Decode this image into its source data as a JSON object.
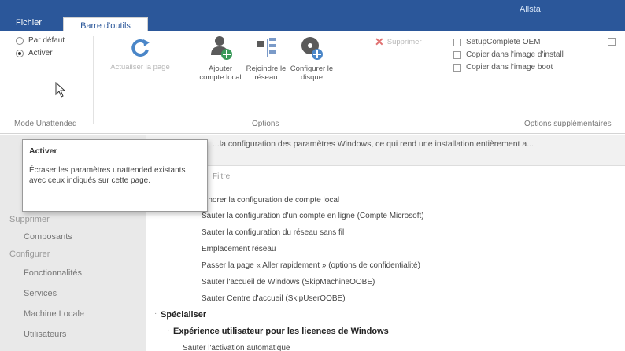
{
  "app": {
    "title": "Allsta"
  },
  "tabs": [
    {
      "label": "Fichier"
    },
    {
      "label": "Barre d'outils"
    }
  ],
  "ribbon": {
    "unattended": {
      "options": [
        {
          "label": "Par défaut",
          "checked": false
        },
        {
          "label": "Activer",
          "checked": true
        }
      ],
      "group_label": "Mode Unattended"
    },
    "buttons": {
      "refresh": {
        "label": "Actualiser la page",
        "icon": "refresh-icon",
        "enabled": false
      },
      "add_account": {
        "label": "Ajouter compte local",
        "icon": "add-user-icon"
      },
      "join_network": {
        "label": "Rejoindre le réseau",
        "icon": "network-icon"
      },
      "configure_disk": {
        "label": "Configurer le disque",
        "icon": "disk-icon"
      },
      "delete": {
        "label": "Supprimer",
        "icon": "delete-icon",
        "enabled": false
      }
    },
    "options_group_label": "Options",
    "checkboxes": [
      {
        "label": "SetupComplete OEM",
        "checked": false
      },
      {
        "label": "Copier dans l'image d'install",
        "checked": false
      },
      {
        "label": "Copier dans l'image boot",
        "checked": false
      }
    ],
    "extra_group_label": "Options supplémentaires"
  },
  "tooltip": {
    "title": "Activer",
    "body": "Écraser les paramètres unattended existants avec ceux indiqués sur cette page."
  },
  "sidebar": {
    "items": [
      {
        "label": "Supprimer",
        "type": "head"
      },
      {
        "label": "Composants",
        "type": "item"
      },
      {
        "label": "Configurer",
        "type": "head"
      },
      {
        "label": "Fonctionnalités",
        "type": "item"
      },
      {
        "label": "Services",
        "type": "item"
      },
      {
        "label": "Machine Locale",
        "type": "item"
      },
      {
        "label": "Utilisateurs",
        "type": "item"
      }
    ]
  },
  "infobar": {
    "text": "...la configuration des paramètres Windows, ce qui rend une installation entièrement a..."
  },
  "main": {
    "column_header": "Filtre",
    "lines": [
      {
        "text": "Ignorer la configuration de compte local",
        "bold": false
      },
      {
        "text": "Sauter la configuration d'un compte en ligne (Compte Microsoft)",
        "bold": false
      },
      {
        "text": "Sauter la configuration du réseau sans fil",
        "bold": false
      },
      {
        "text": "Emplacement réseau",
        "bold": false
      },
      {
        "text": "Passer la page « Aller rapidement » (options de confidentialité)",
        "bold": false
      },
      {
        "text": "Sauter l'accueil de Windows (SkipMachineOOBE)",
        "bold": false
      },
      {
        "text": "Sauter Centre d'accueil (SkipUserOOBE)",
        "bold": false
      },
      {
        "text": "Spécialiser",
        "bold": true
      },
      {
        "text": "Expérience utilisateur pour les licences de Windows",
        "bold": true
      },
      {
        "text": "Sauter l'activation automatique",
        "bold": false
      }
    ]
  },
  "colors": {
    "titlebar": "#2b579a",
    "sidebar": "#e9e9e9",
    "accent_blue": "#4a86c8"
  }
}
